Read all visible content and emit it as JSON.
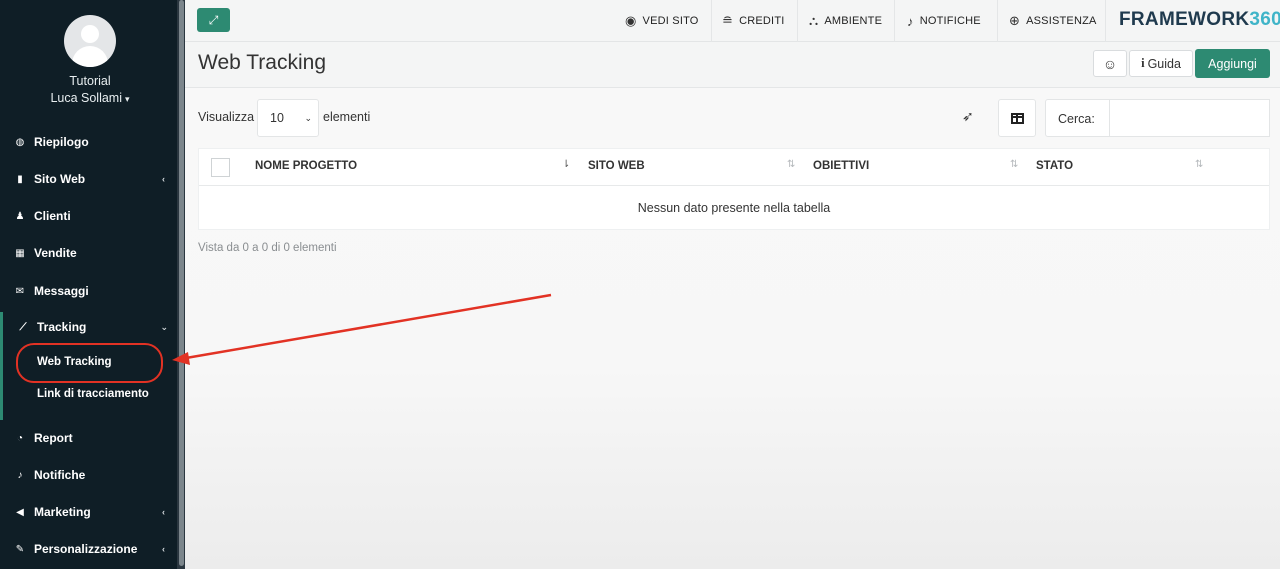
{
  "user": {
    "role": "Tutorial",
    "name": "Luca Sollami",
    "caret": "▾"
  },
  "sidebar": {
    "items": [
      {
        "label": "Riepilogo",
        "icon": "dashboard-icon",
        "glyph": "◍",
        "chevron": ""
      },
      {
        "label": "Sito Web",
        "icon": "file-icon",
        "glyph": "▮",
        "chevron": "‹"
      },
      {
        "label": "Clienti",
        "icon": "user-icon",
        "glyph": "♟",
        "chevron": ""
      },
      {
        "label": "Vendite",
        "icon": "calculator-icon",
        "glyph": "▦",
        "chevron": ""
      },
      {
        "label": "Messaggi",
        "icon": "envelope-icon",
        "glyph": "✉",
        "chevron": ""
      },
      {
        "label": "Tracking",
        "icon": "chart-icon",
        "glyph": "⟋",
        "chevron": "⌄"
      },
      {
        "label": "Report",
        "icon": "pie-chart-icon",
        "glyph": "◔",
        "chevron": ""
      },
      {
        "label": "Notifiche",
        "icon": "bell-icon",
        "glyph": "♪",
        "chevron": ""
      },
      {
        "label": "Marketing",
        "icon": "megaphone-icon",
        "glyph": "◀",
        "chevron": "‹"
      },
      {
        "label": "Personalizzazione",
        "icon": "brush-icon",
        "glyph": "✎",
        "chevron": "‹"
      }
    ],
    "tracking_sub": [
      "Web Tracking",
      "Link di tracciamento"
    ]
  },
  "topbar": {
    "expand_glyph": "⤢",
    "links": [
      {
        "label": "VEDI SITO",
        "icon": "eye-icon",
        "glyph": "◉"
      },
      {
        "label": "CREDITI",
        "icon": "coins-icon",
        "glyph": "≘"
      },
      {
        "label": "AMBIENTE",
        "icon": "cubes-icon",
        "glyph": "⛬"
      },
      {
        "label": "NOTIFICHE",
        "icon": "bell-icon",
        "glyph": "♪"
      },
      {
        "label": "ASSISTENZA",
        "icon": "lifebuoy-icon",
        "glyph": "⊕"
      }
    ],
    "brand_a": "FRAMEWORK",
    "brand_b": "360"
  },
  "header": {
    "title": "Web Tracking",
    "smile_glyph": "☺",
    "guide_i": "i",
    "guide_label": "Guida",
    "add_label": "Aggiungi"
  },
  "table": {
    "show_label": "Visualizza",
    "length_value": "10",
    "length_arrow": "⌄",
    "elements_label": "elementi",
    "search_label": "Cerca:",
    "columns": [
      "NOME PROGETTO",
      "SITO WEB",
      "OBIETTIVI",
      "STATO"
    ],
    "sort_glyph": "⇅",
    "sort_active_glyph": "⇂",
    "empty_message": "Nessun dato presente nella tabella",
    "info": "Vista da 0 a 0 di 0 elementi"
  },
  "colors": {
    "accent": "#2d8a72",
    "sidebar_bg": "#0f1e26",
    "annotation": "#e23224"
  }
}
